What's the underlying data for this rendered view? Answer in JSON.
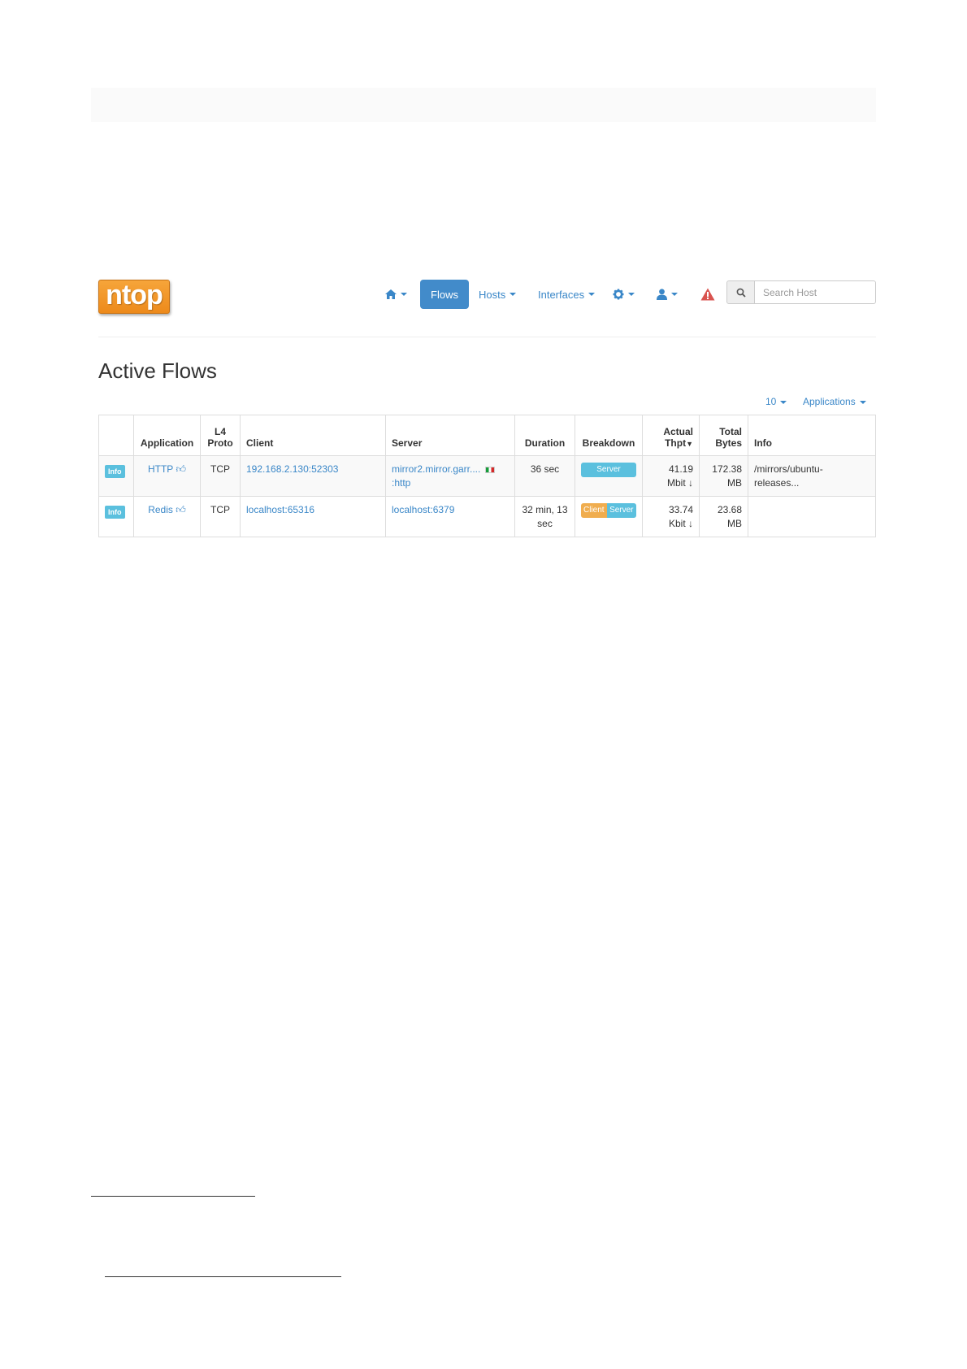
{
  "brand": {
    "logo_text": "ntop"
  },
  "nav": {
    "home_icon": "home-icon",
    "flows_label": "Flows",
    "hosts_label": "Hosts",
    "interfaces_label": "Interfaces",
    "settings_icon": "gear-icon",
    "user_icon": "user-icon",
    "alert_icon": "warning-icon"
  },
  "search": {
    "placeholder": "Search Host",
    "icon": "search-icon"
  },
  "page": {
    "title": "Active Flows"
  },
  "table_controls": {
    "page_size": "10",
    "filter_label": "Applications"
  },
  "table": {
    "headers": {
      "application": "Application",
      "l4_line1": "L4",
      "l4_line2": "Proto",
      "client": "Client",
      "server": "Server",
      "duration": "Duration",
      "breakdown": "Breakdown",
      "thpt_line1": "Actual",
      "thpt_line2": "Thpt",
      "bytes_line1": "Total",
      "bytes_line2": "Bytes",
      "info": "Info"
    },
    "rows": [
      {
        "info_badge": "Info",
        "application": "HTTP",
        "l4_proto": "TCP",
        "client": "192.168.2.130:52303",
        "server_line1": "mirror2.mirror.garr....",
        "server_line2": ":http",
        "duration": "36 sec",
        "breakdown_server": "Server",
        "thpt_value": "41.19",
        "thpt_unit": "Mbit",
        "bytes_value": "172.38",
        "bytes_unit": "MB",
        "info_line1": "/mirrors/ubuntu-",
        "info_line2": "releases..."
      },
      {
        "info_badge": "Info",
        "application": "Redis",
        "l4_proto": "TCP",
        "client": "localhost:65316",
        "server_line1": "localhost:6379",
        "duration_line1": "32 min, 13",
        "duration_line2": "sec",
        "breakdown_client": "Client",
        "breakdown_server": "Server",
        "thpt_value": "33.74",
        "thpt_unit": "Kbit",
        "bytes_value": "23.68",
        "bytes_unit": "MB"
      }
    ]
  },
  "colors": {
    "accent": "#428bca",
    "link": "#3a87c8",
    "badge": "#5bc0de",
    "client_bar": "#f0ad4e",
    "logo": "#ed8a1b",
    "alert": "#d9534f"
  }
}
